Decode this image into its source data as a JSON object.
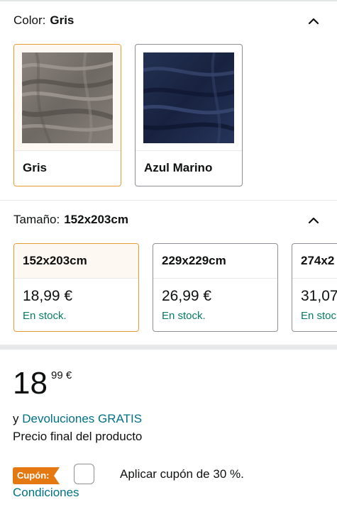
{
  "color_section": {
    "label": "Color:",
    "selected_value": "Gris",
    "options": [
      {
        "name": "Gris",
        "selected": true,
        "swatch_color": "#7a7470"
      },
      {
        "name": "Azul Marino",
        "selected": false,
        "swatch_color": "#1e2a4a"
      }
    ],
    "collapse_icon": "chevron-up-icon"
  },
  "size_section": {
    "label": "Tamaño:",
    "selected_value": "152x203cm",
    "options": [
      {
        "size": "152x203cm",
        "price": "18,99 €",
        "stock": "En stock.",
        "selected": true
      },
      {
        "size": "229x229cm",
        "price": "26,99 €",
        "stock": "En stock.",
        "selected": false
      },
      {
        "size": "274x2",
        "price": "31,07",
        "stock": "En stoc",
        "selected": false
      }
    ],
    "collapse_icon": "chevron-up-icon"
  },
  "price": {
    "whole": "18",
    "fraction_currency": "99 €"
  },
  "returns": {
    "prefix": "y ",
    "link": "Devoluciones GRATIS"
  },
  "final_price_note": "Precio final del producto",
  "coupon": {
    "badge": "Cupón:",
    "text": "Aplicar cupón de 30 %.",
    "conditions_link": "Condiciones"
  },
  "colors": {
    "accent_selected_border": "#e59e33",
    "link": "#007185",
    "stock_green": "#067d62",
    "coupon_orange": "#e47911"
  }
}
